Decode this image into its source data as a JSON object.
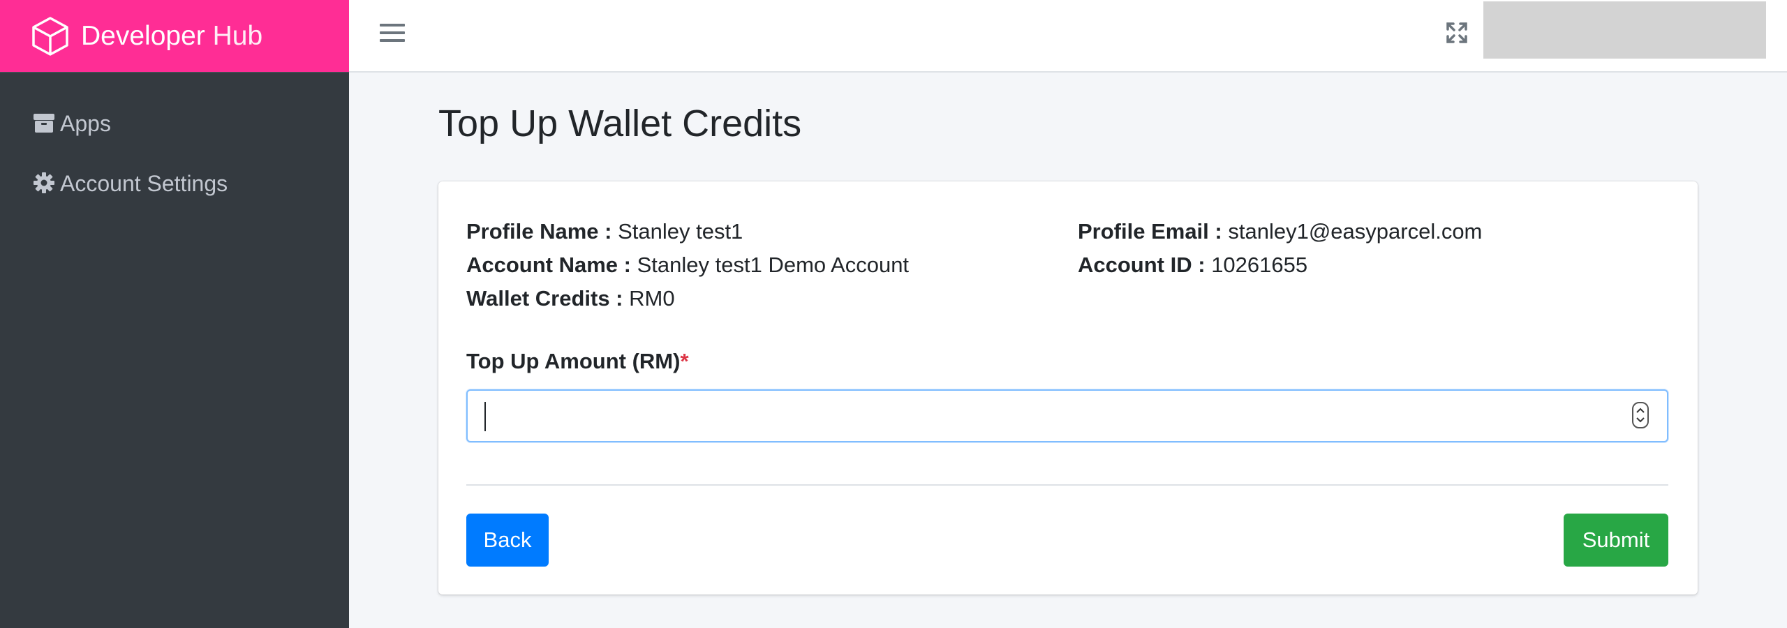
{
  "brand": {
    "name_bold": "Developer",
    "name_light": "Hub"
  },
  "sidebar": {
    "items": [
      {
        "label": "Apps",
        "icon": "box-icon"
      },
      {
        "label": "Account Settings",
        "icon": "gear-icon"
      }
    ]
  },
  "header": {
    "menu_icon": "hamburger-icon",
    "expand_icon": "expand-icon"
  },
  "page": {
    "title": "Top Up Wallet Credits"
  },
  "profile": {
    "profile_name_label": "Profile Name :",
    "profile_name": "Stanley test1",
    "account_name_label": "Account Name :",
    "account_name": "Stanley test1 Demo Account",
    "wallet_credits_label": "Wallet Credits :",
    "wallet_credits": "RM0",
    "profile_email_label": "Profile Email :",
    "profile_email": "stanley1@easyparcel.com",
    "account_id_label": "Account ID :",
    "account_id": "10261655"
  },
  "form": {
    "amount_label": "Top Up Amount (RM)",
    "required_mark": "*",
    "amount_value": ""
  },
  "actions": {
    "back_label": "Back",
    "submit_label": "Submit"
  },
  "colors": {
    "brand": "#ff2d95",
    "sidebar": "#343a40",
    "primary": "#007bff",
    "success": "#28a745",
    "required": "#dc3545"
  }
}
